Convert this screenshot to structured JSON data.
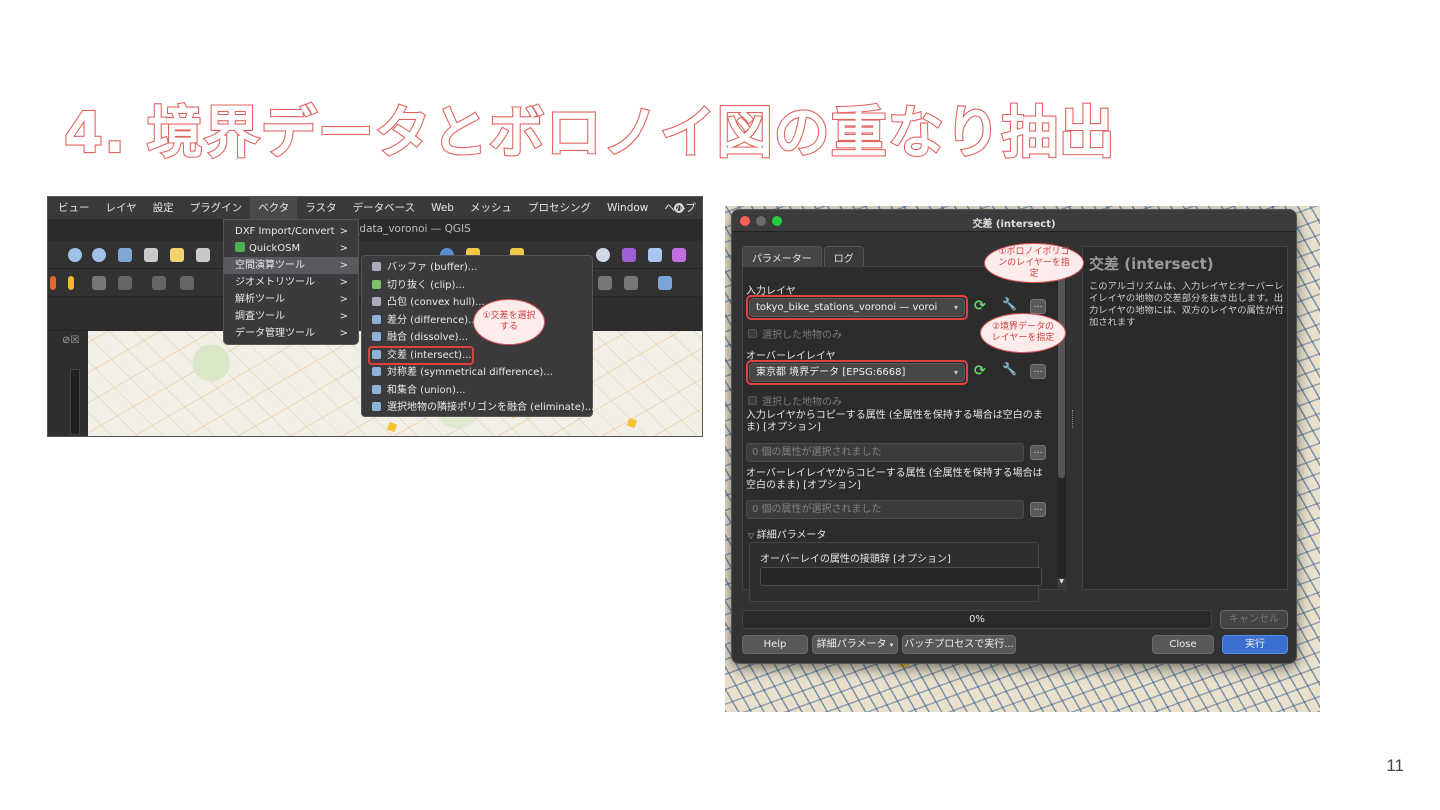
{
  "slide": {
    "title": "4. 境界データとボロノイ図の重なり抽出",
    "page_number": "11"
  },
  "qgis_menu": {
    "menubar": [
      "ビュー",
      "レイヤ",
      "設定",
      "プラグイン",
      "ベクタ",
      "ラスタ",
      "データベース",
      "Web",
      "メッシュ",
      "プロセシング",
      "Window",
      "ヘルプ"
    ],
    "active_menu": "ベクタ",
    "window_title": "lity_data_voronoi — QGIS",
    "vector_menu_items": [
      {
        "label": "DXF Import/Convert",
        "arrow": ">"
      },
      {
        "label": "QuickOSM",
        "arrow": ">"
      },
      {
        "label": "空間演算ツール",
        "arrow": ">"
      },
      {
        "label": "ジオメトリツール",
        "arrow": ">"
      },
      {
        "label": "解析ツール",
        "arrow": ">"
      },
      {
        "label": "調査ツール",
        "arrow": ">"
      },
      {
        "label": "データ管理ツール",
        "arrow": ">"
      }
    ],
    "geoprocessing_items": [
      "バッファ (buffer)...",
      "切り抜く (clip)...",
      "凸包 (convex hull)...",
      "差分 (difference)...",
      "融合 (dissolve)...",
      "交差 (intersect)...",
      "対称差 (symmetrical difference)...",
      "和集合 (union)...",
      "選択地物の隣接ポリゴンを融合 (eliminate)..."
    ],
    "highlighted_item": "交差 (intersect)...",
    "callout_1": "①交差を選択する",
    "map_panel_icons": "⊘☒"
  },
  "intersect_dialog": {
    "title": "交差 (intersect)",
    "tabs": [
      "パラメーター",
      "ログ"
    ],
    "input_layer_label": "入力レイヤ",
    "input_layer_value": "tokyo_bike_stations_voronoi — voroi",
    "selected_only_1": "選択した地物のみ",
    "overlay_layer_label": "オーバーレイレイヤ",
    "overlay_layer_value": "東京都 境界データ [EPSG:6668]",
    "selected_only_2": "選択した地物のみ",
    "input_fields_label": "入力レイヤからコピーする属性 (全属性を保持する場合は空白のまま) [オプション]",
    "input_fields_value": "0 個の属性が選択されました",
    "overlay_fields_label": "オーバーレイレイヤからコピーする属性 (全属性を保持する場合は空白のまま) [オプション]",
    "overlay_fields_value": "0 個の属性が選択されました",
    "advanced_label": "詳細パラメータ",
    "overlay_prefix_label": "オーバーレイの属性の接頭辞 [オプション]",
    "overlay_prefix_value": "",
    "help_title": "交差 (intersect)",
    "help_text": "このアルゴリズムは、入力レイヤとオーバーレイレイヤの地物の交差部分を抜き出します。出力レイヤの地物には、双方のレイヤの属性が付加されます",
    "progress": "0%",
    "cancel_button": "キャンセル",
    "help_button": "Help",
    "advanced_button": "詳細パラメータ",
    "batch_button": "バッチプロセスで実行...",
    "close_button": "Close",
    "run_button": "実行",
    "callout_1": "①ボロノイポリゴンのレイヤーを指定",
    "callout_2": "②境界データのレイヤーを指定",
    "colors": {
      "highlight": "#e04040",
      "callout_fill": "#fdecec",
      "title_outline": "#e0645f"
    }
  }
}
